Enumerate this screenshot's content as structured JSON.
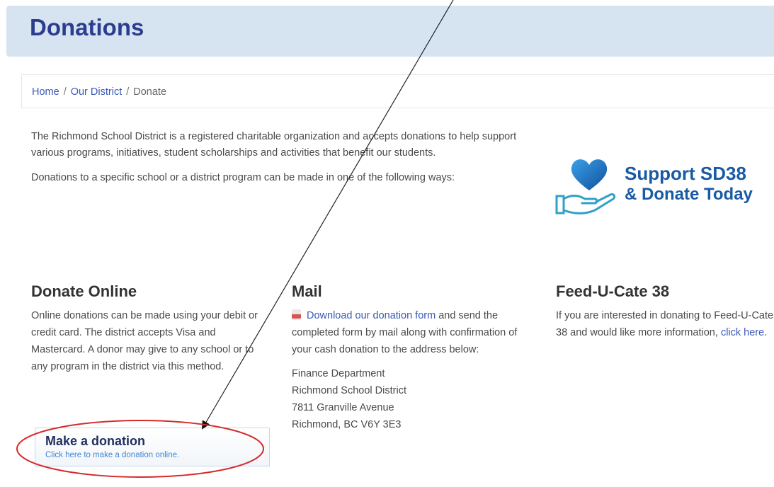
{
  "header": {
    "title": "Donations"
  },
  "breadcrumb": {
    "home": "Home",
    "district": "Our District",
    "current": "Donate",
    "separator": "/"
  },
  "intro": {
    "p1": "The Richmond School District is a registered charitable organization and accepts donations to help support various programs, initiatives, student scholarships and activities that benefit our students.",
    "p2": "Donations to a specific school or a district program can be made in one of the following ways:"
  },
  "badge": {
    "line1": "Support SD38",
    "line2": "& Donate Today",
    "icon": "heart-hand-icon",
    "color": "#1a5aa5"
  },
  "online": {
    "heading": "Donate Online",
    "text": "Online donations can be made using your debit or credit card. The district accepts Visa and Mastercard.  A donor may give to any school or to any program in the district via this method.",
    "button_title": "Make a donation",
    "button_sub": "Click here to make a donation online."
  },
  "mail": {
    "heading": "Mail",
    "link": "Download our donation form",
    "text": " and send the completed form by mail along with confirmation of your cash donation to the address below:",
    "address": [
      "Finance Department",
      "Richmond School District",
      "7811 Granville Avenue",
      "Richmond, BC  V6Y 3E3"
    ]
  },
  "feed": {
    "heading": "Feed-U-Cate 38",
    "text": "If you are interested in donating to Feed-U-Cate 38 and would like more information, ",
    "link": "click here",
    "after": "."
  },
  "colors": {
    "accent": "#2c3d8f",
    "link": "#3a59b5",
    "annotation": "#d62a2a"
  }
}
